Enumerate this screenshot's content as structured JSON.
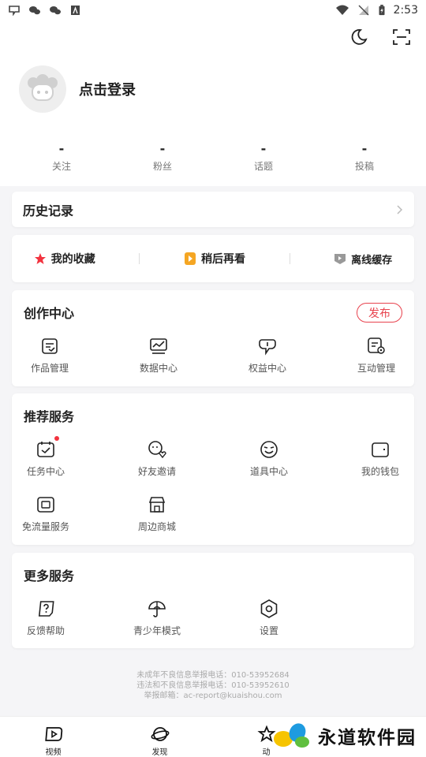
{
  "status_bar": {
    "time": "2:53"
  },
  "profile": {
    "login_label": "点击登录"
  },
  "stats": [
    {
      "value": "-",
      "label": "关注"
    },
    {
      "value": "-",
      "label": "粉丝"
    },
    {
      "value": "-",
      "label": "话题"
    },
    {
      "value": "-",
      "label": "投稿"
    }
  ],
  "history": {
    "title": "历史记录"
  },
  "quick": {
    "favorites": "我的收藏",
    "watch_later": "稍后再看",
    "offline": "离线缓存"
  },
  "create_center": {
    "title": "创作中心",
    "publish": "发布",
    "items": [
      "作品管理",
      "数据中心",
      "权益中心",
      "互动管理"
    ]
  },
  "recommend": {
    "title": "推荐服务",
    "items": [
      "任务中心",
      "好友邀请",
      "道具中心",
      "我的钱包",
      "免流量服务",
      "周边商城"
    ]
  },
  "more_services": {
    "title": "更多服务",
    "items": [
      "反馈帮助",
      "青少年模式",
      "设置"
    ]
  },
  "footer": {
    "line1": "未成年不良信息举报电话：010-53952684",
    "line2": "违法和不良信息举报电话：010-53952610",
    "line3": "举报邮箱：ac-report@kuaishou.com"
  },
  "tabs": [
    "视频",
    "发现",
    "动"
  ],
  "watermark": {
    "text": "永道软件园"
  },
  "colors": {
    "accent": "#e8434e",
    "orange": "#f5a623",
    "red_star": "#f2333f"
  }
}
